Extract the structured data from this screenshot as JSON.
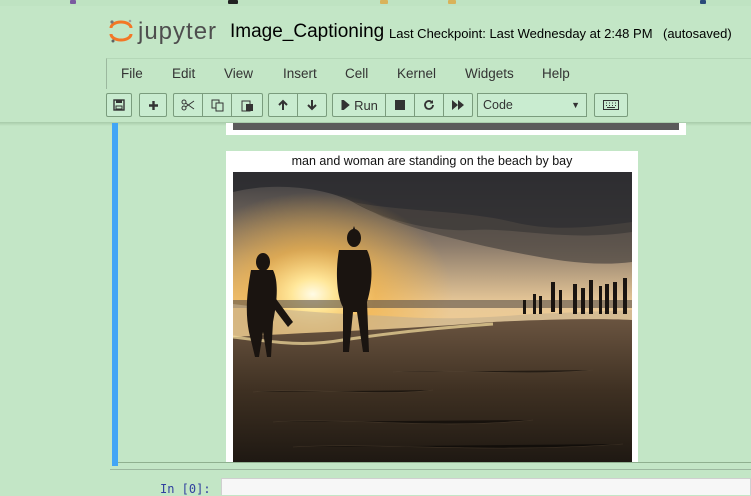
{
  "header": {
    "logo_text": "jupyter",
    "notebook_name": "Image_Captioning",
    "checkpoint": "Last Checkpoint: Last Wednesday at 2:48 PM",
    "save_status": "(autosaved)"
  },
  "menu": {
    "file": "File",
    "edit": "Edit",
    "view": "View",
    "insert": "Insert",
    "cell": "Cell",
    "kernel": "Kernel",
    "widgets": "Widgets",
    "help": "Help"
  },
  "toolbar": {
    "run_label": "Run",
    "cell_type": "Code",
    "cell_type_options": [
      "Code"
    ]
  },
  "output": {
    "caption": "man and woman are standing on the beach by bay"
  },
  "next_cell": {
    "prompt": "In [0]:"
  },
  "icons": [
    "save-icon",
    "plus-icon",
    "cut-icon",
    "copy-icon",
    "paste-icon",
    "arrow-up-icon",
    "arrow-down-icon",
    "run-icon",
    "stop-icon",
    "restart-icon",
    "fast-forward-icon",
    "keyboard-icon"
  ]
}
